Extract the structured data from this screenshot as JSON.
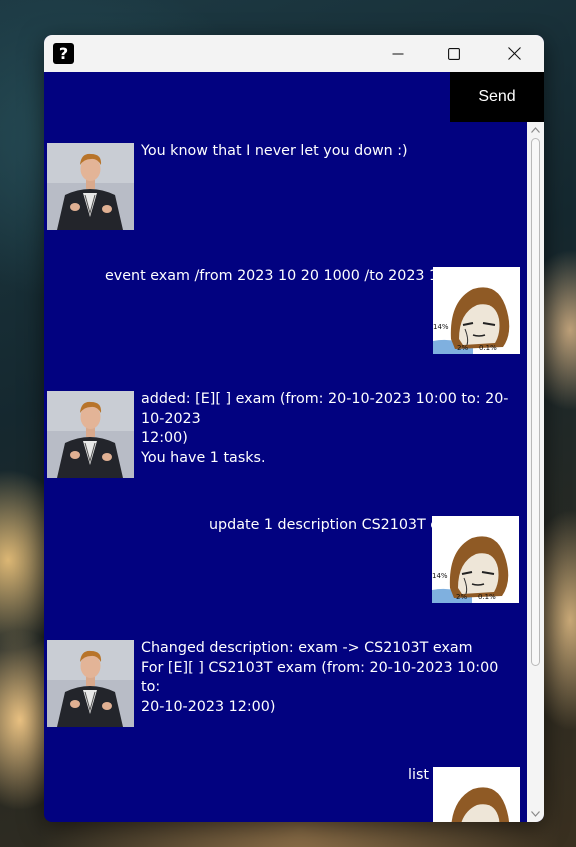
{
  "window": {
    "app_icon_glyph": "?",
    "controls": [
      "minimize-icon",
      "maximize-icon",
      "close-icon"
    ]
  },
  "input": {
    "value": "",
    "send_label": "Send"
  },
  "dialog": [
    {
      "sender": "duke",
      "text": "You know that I never let you down :)"
    },
    {
      "sender": "user",
      "text": "event exam /from 2023 10 20 1000 /to 2023 10 20 1200"
    },
    {
      "sender": "duke",
      "text": "added: [E][ ] exam (from: 20-10-2023 10:00 to: 20-10-2023\n12:00)\nYou have 1 tasks."
    },
    {
      "sender": "user",
      "text": "update 1 description CS2103T exam"
    },
    {
      "sender": "duke",
      "text": "Changed description: exam -> CS2103T exam\nFor [E][ ] CS2103T exam (from: 20-10-2023 10:00 to:\n20-10-2023 12:00)"
    },
    {
      "sender": "user",
      "text": "list"
    }
  ],
  "user_avatar_caption": {
    "a": "14%",
    "b": "2%",
    "c": "0.1%"
  },
  "colors": {
    "dialog_background": "#020280",
    "send_button": "#000000",
    "titlebar": "#f3f3f3",
    "text": "#ffffff"
  }
}
